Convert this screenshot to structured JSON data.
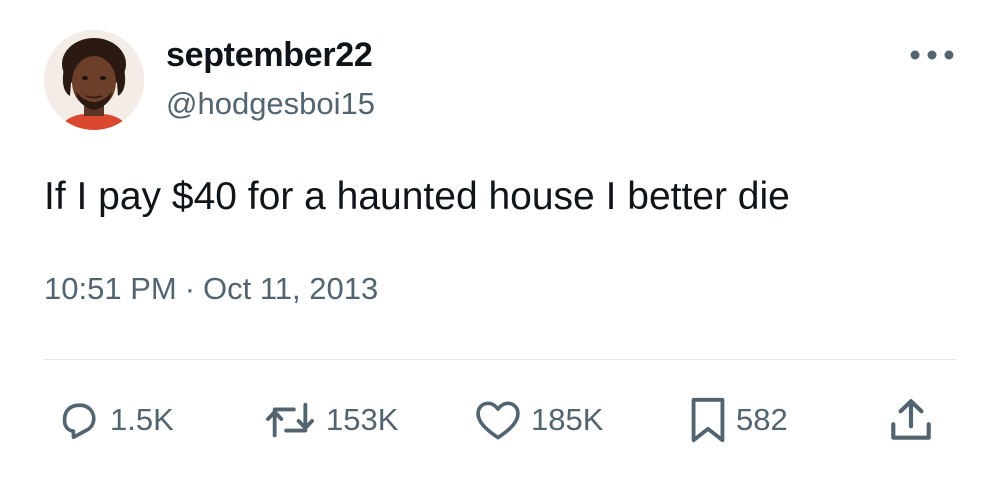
{
  "author": {
    "display_name": "september22",
    "handle": "@hodgesboi15"
  },
  "tweet": {
    "text": "If I pay $40 for a haunted house I better die",
    "time": "10:51 PM",
    "separator": "·",
    "date": "Oct 11, 2013"
  },
  "actions": {
    "replies": "1.5K",
    "retweets": "153K",
    "likes": "185K",
    "bookmarks": "582"
  },
  "icons": {
    "more": "more-horizontal-icon",
    "reply": "reply-icon",
    "retweet": "retweet-icon",
    "like": "heart-icon",
    "bookmark": "bookmark-icon",
    "share": "share-icon"
  },
  "colors": {
    "text_primary": "#0f1419",
    "text_secondary": "#536471",
    "divider": "#e4e8eb"
  }
}
